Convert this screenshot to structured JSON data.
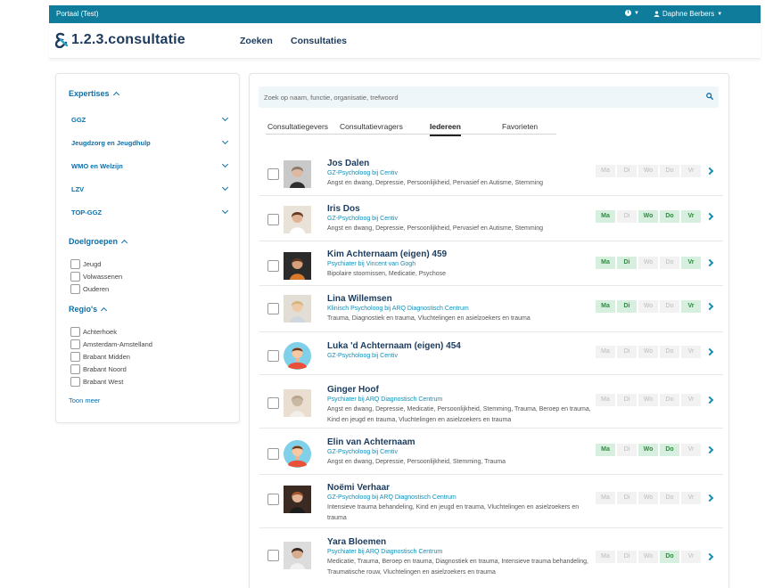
{
  "topbar": {
    "portal": "Portaal (Test)",
    "user": "Daphne Berbers"
  },
  "header": {
    "logo_text": "1.2.3.consultatie",
    "nav": [
      "Zoeken",
      "Consultaties"
    ]
  },
  "sidebar": {
    "expertises_title": "Expertises",
    "expertises": [
      "GGZ",
      "Jeugdzorg en Jeugdhulp",
      "WMO en Welzijn",
      "LZV",
      "TOP-GGZ"
    ],
    "doelgroepen_title": "Doelgroepen",
    "doelgroepen": [
      "Jeugd",
      "Volwassenen",
      "Ouderen"
    ],
    "regios_title": "Regio's",
    "regios": [
      "Achterhoek",
      "Amsterdam-Amstelland",
      "Brabant Midden",
      "Brabant Noord",
      "Brabant West"
    ],
    "toon_meer": "Toon meer"
  },
  "search": {
    "placeholder": "Zoek op naam, functie, organisatie, trefwoord"
  },
  "tabs": [
    "Consultatiegevers",
    "Consultatievragers",
    "Iedereen",
    "Favorieten"
  ],
  "active_tab": "Iedereen",
  "day_labels": [
    "Ma",
    "Di",
    "Wo",
    "Do",
    "Vr"
  ],
  "people": [
    {
      "name": "Jos Dalen",
      "role": "GZ-Psycholoog bij Centiv",
      "tags": "Angst en dwang, Depressie, Persoonlijkheid, Pervasief en Autisme, Stemming",
      "avatar": "photo-man",
      "days": [
        false,
        false,
        false,
        false,
        false
      ]
    },
    {
      "name": "Iris Dos",
      "role": "GZ-Psycholoog bij Centiv",
      "tags": "Angst en dwang, Depressie, Persoonlijkheid, Pervasief en Autisme, Stemming",
      "avatar": "photo-woman",
      "days": [
        true,
        false,
        true,
        true,
        true
      ]
    },
    {
      "name": "Kim Achternaam (eigen) 459",
      "role": "Psychiater bij Vincent van Gogh",
      "tags": "Bipolaire stoornissen, Medicatie, Psychose",
      "avatar": "photo-woman-dark",
      "days": [
        true,
        true,
        false,
        false,
        true
      ]
    },
    {
      "name": "Lina Willemsen",
      "role": "Klinisch Psycholoog bij ARQ Diagnostisch Centrum",
      "tags": "Trauma, Diagnostiek en trauma, Vluchtelingen en asielzoekers en trauma",
      "avatar": "photo-woman-blonde",
      "days": [
        true,
        true,
        false,
        false,
        true
      ]
    },
    {
      "name": "Luka 'd Achternaam (eigen) 454",
      "role": "GZ-Psycholoog bij Centiv",
      "tags": "",
      "avatar": "avatar-placeholder",
      "days": [
        false,
        false,
        false,
        false,
        false
      ]
    },
    {
      "name": "Ginger Hoof",
      "role": "Psychiater bij ARQ Diagnostisch Centrum",
      "tags": "Angst en dwang, Depressie, Medicatie, Persoonlijkheid, Stemming, Trauma, Beroep en trauma, Kind en jeugd en trauma, Vluchtelingen en asielzoekers en trauma",
      "avatar": "photo-room",
      "days": [
        false,
        false,
        false,
        false,
        false
      ]
    },
    {
      "name": "Elin van Achternaam",
      "role": "GZ-Psycholoog bij Centiv",
      "tags": "Angst en dwang, Depressie, Persoonlijkheid, Stemming, Trauma",
      "avatar": "avatar-placeholder",
      "days": [
        true,
        false,
        true,
        true,
        false
      ]
    },
    {
      "name": "Noëmi Verhaar",
      "role": "GZ-Psycholoog bij ARQ Diagnostisch Centrum",
      "tags": "Intensieve trauma behandeling, Kind en jeugd en trauma, Vluchtelingen en asielzoekers en trauma",
      "avatar": "photo-woman-red",
      "days": [
        false,
        false,
        false,
        false,
        false
      ]
    },
    {
      "name": "Yara Bloemen",
      "role": "Psychiater bij ARQ Diagnostisch Centrum",
      "tags": "Medicatie, Trauma, Beroep en trauma, Diagnostiek en trauma, Intensieve trauma behandeling, Traumatische rouw, Vluchtelingen en asielzoekers en trauma",
      "avatar": "photo-woman-sitting",
      "days": [
        false,
        false,
        false,
        true,
        false
      ]
    }
  ],
  "colors": {
    "brand": "#0f7c9b",
    "link": "#0f6fa8",
    "day_on": "#d7efde",
    "day_on_text": "#2f8a3f"
  }
}
